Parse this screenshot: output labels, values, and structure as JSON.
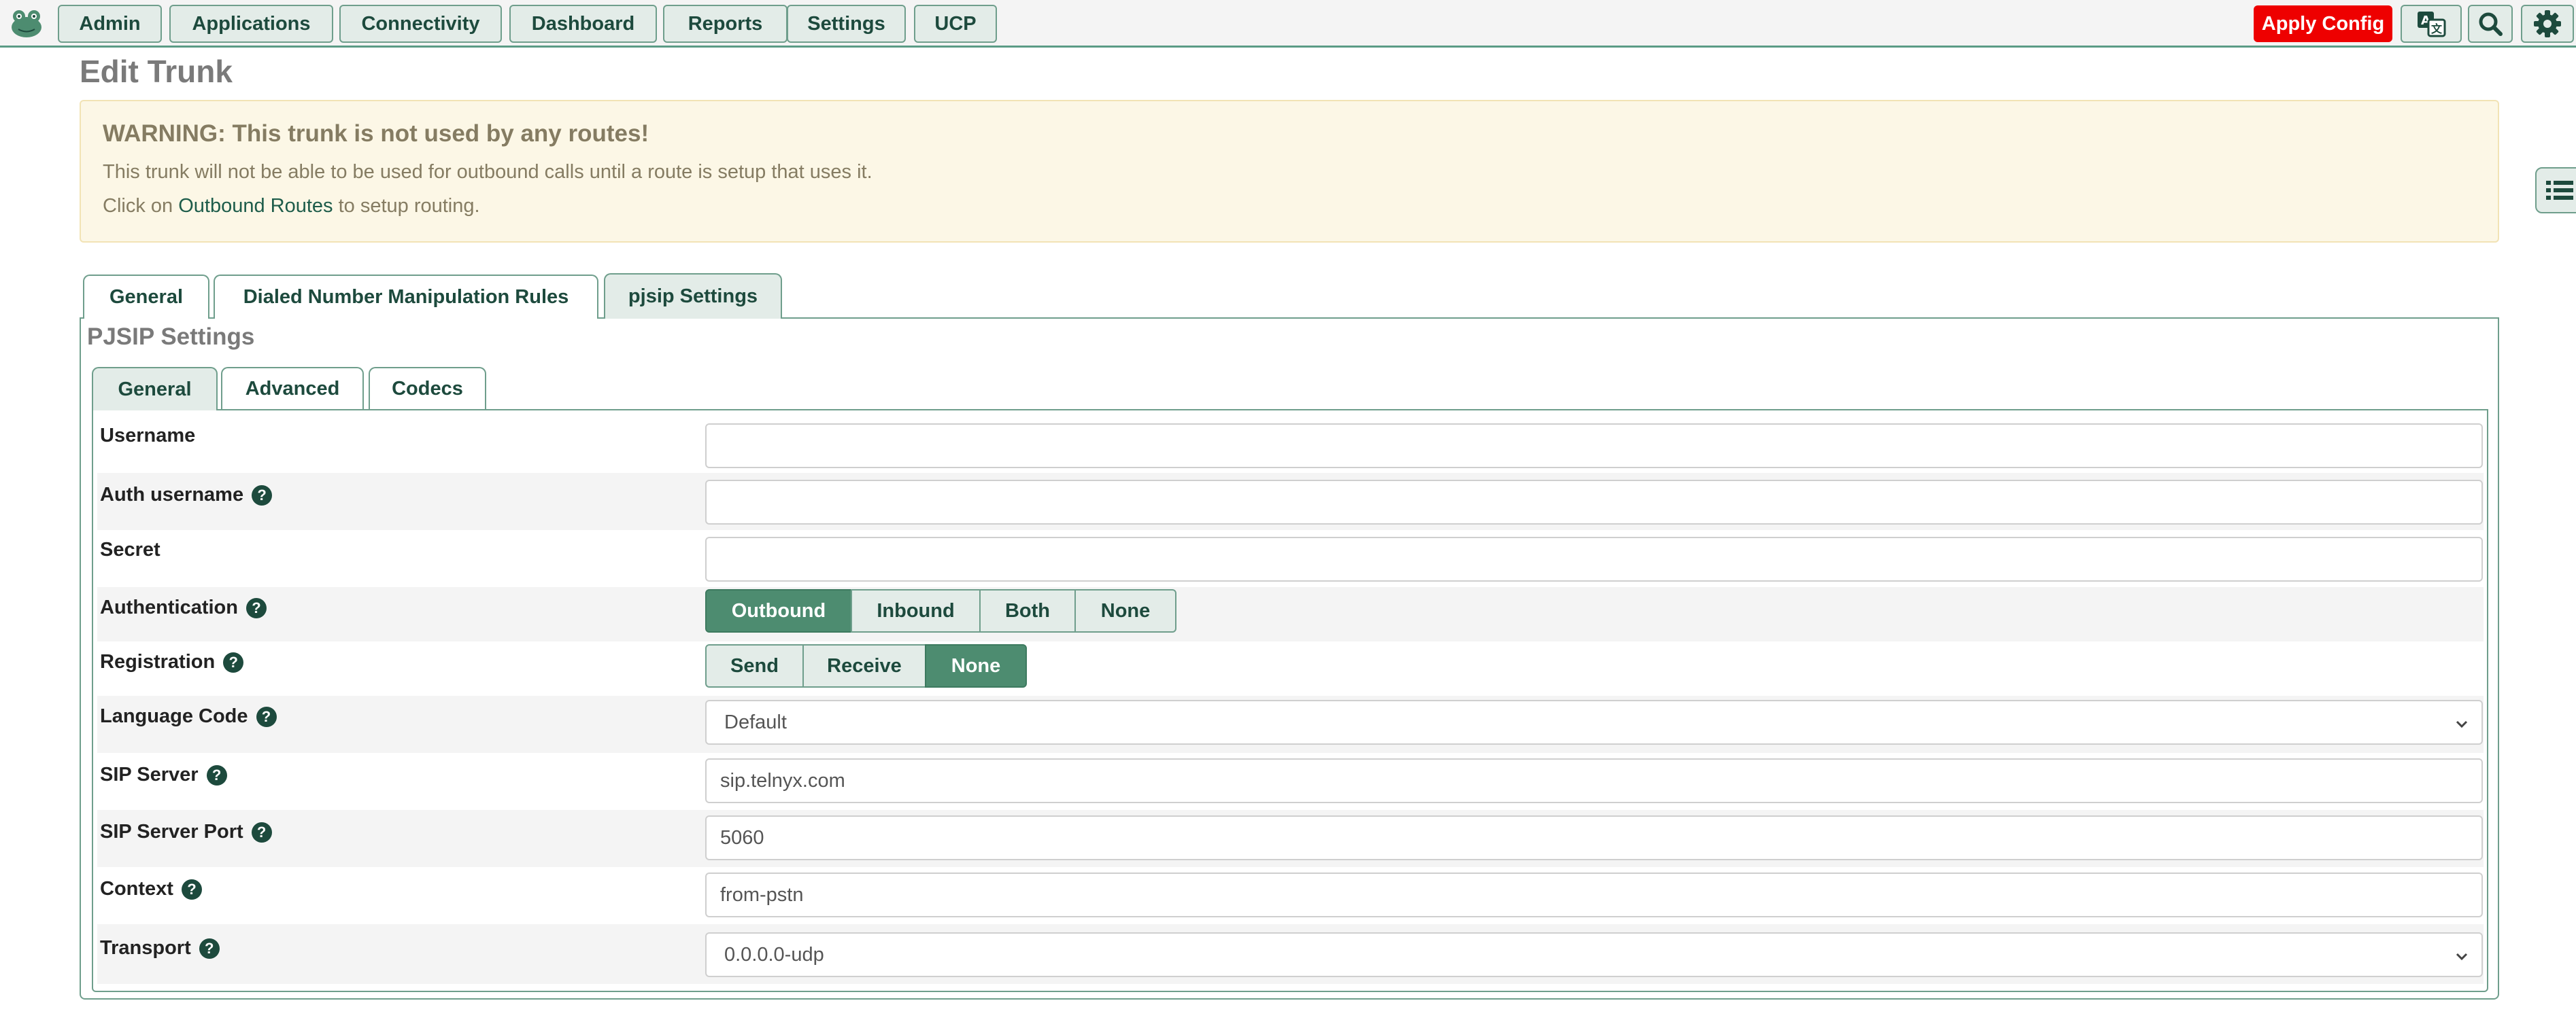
{
  "nav": {
    "items": [
      "Admin",
      "Applications",
      "Connectivity",
      "Dashboard",
      "Reports",
      "Settings",
      "UCP"
    ],
    "apply_config": "Apply Config",
    "icons": [
      "frog-logo-icon",
      "translate-icon",
      "search-icon",
      "gear-icon"
    ]
  },
  "page": {
    "title": "Edit Trunk",
    "warning": {
      "heading": "WARNING: This trunk is not used by any routes!",
      "line1": "This trunk will not be able to be used for outbound calls until a route is setup that uses it.",
      "line2_prefix": "Click on ",
      "line2_link": "Outbound Routes",
      "line2_suffix": " to setup routing."
    }
  },
  "tabs": [
    "General",
    "Dialed Number Manipulation Rules",
    "pjsip Settings"
  ],
  "active_tab": "pjsip Settings",
  "section": {
    "title": "PJSIP Settings",
    "subtabs": [
      "General",
      "Advanced",
      "Codecs"
    ],
    "active_subtab": "General"
  },
  "form": {
    "username": {
      "label": "Username",
      "value": ""
    },
    "auth_username": {
      "label": "Auth username",
      "value": ""
    },
    "secret": {
      "label": "Secret",
      "value": ""
    },
    "authentication": {
      "label": "Authentication",
      "options": [
        "Outbound",
        "Inbound",
        "Both",
        "None"
      ],
      "selected": "Outbound"
    },
    "registration": {
      "label": "Registration",
      "options": [
        "Send",
        "Receive",
        "None"
      ],
      "selected": "None"
    },
    "language_code": {
      "label": "Language Code",
      "value": "Default"
    },
    "sip_server": {
      "label": "SIP Server",
      "value": "sip.telnyx.com"
    },
    "sip_server_port": {
      "label": "SIP Server Port",
      "value": "5060"
    },
    "context": {
      "label": "Context",
      "value": "from-pstn"
    },
    "transport": {
      "label": "Transport",
      "value": "0.0.0.0-udp"
    }
  },
  "help_glyph": "?",
  "colors": {
    "accent": "#4d8c70",
    "button_bg": "#e3ece8",
    "apply": "#ee0000",
    "warning_bg": "#fcf7e6"
  }
}
